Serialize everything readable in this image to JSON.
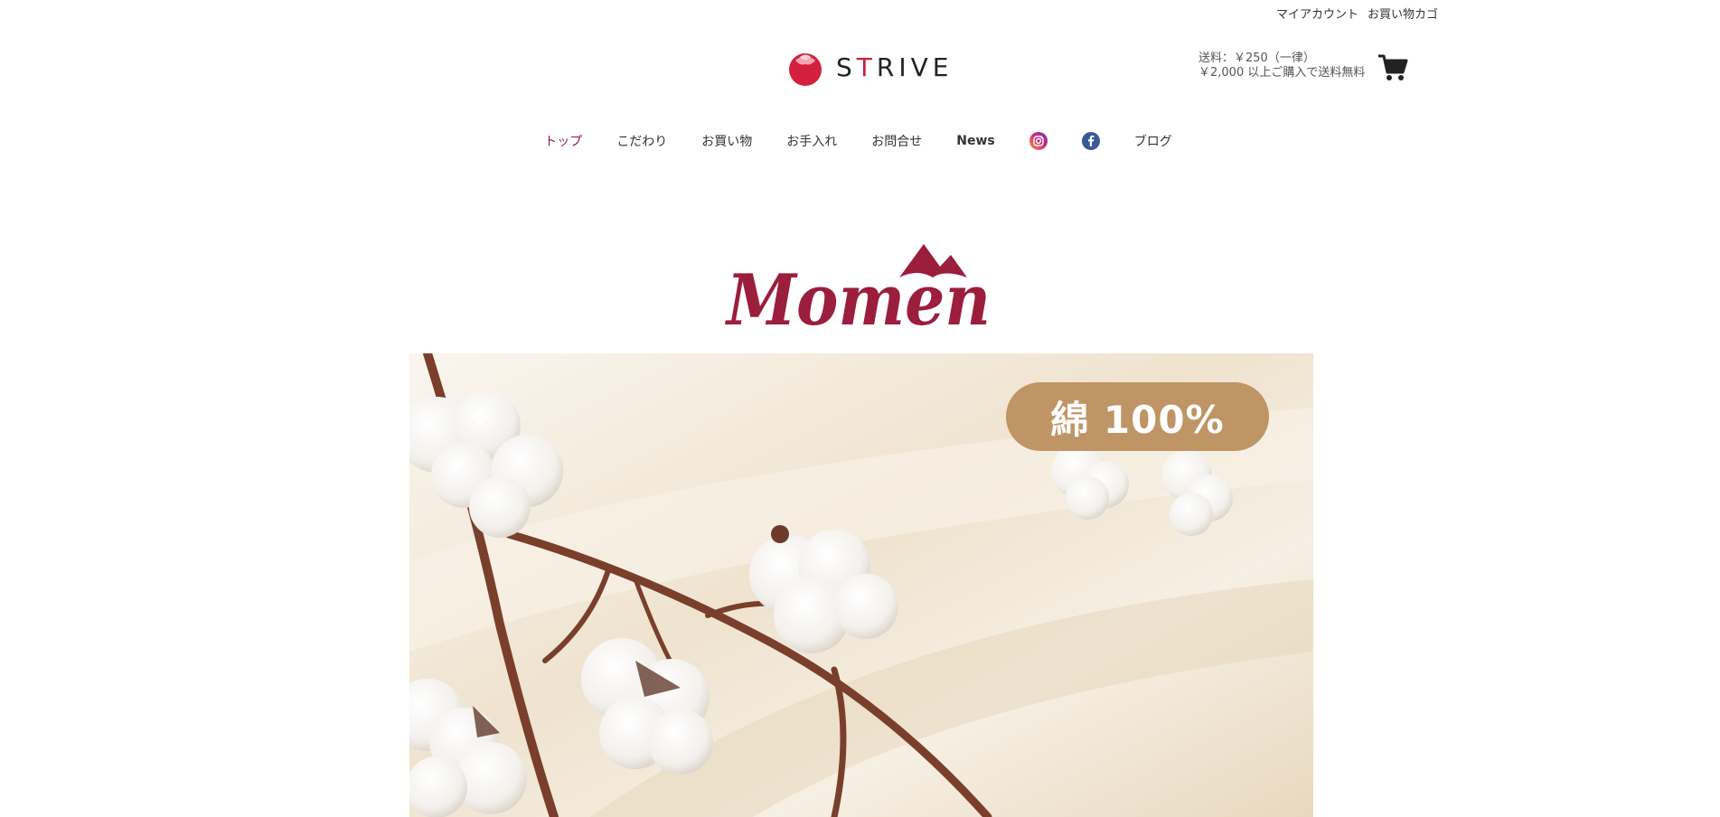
{
  "header": {
    "utility_links": [
      {
        "label": "マイアカウント"
      },
      {
        "label": "お買い物カゴ"
      }
    ],
    "logo": {
      "text_pre": "S",
      "text_accent": "T",
      "text_post": "RIVE",
      "mark_icon": "drop-logo-icon",
      "brand_color": "#c8203c"
    },
    "shipping": {
      "line1": "送料：￥250（一律）",
      "line2": "￥2,000 以上ご購入で送料無料"
    },
    "cart_icon": "shopping-cart-icon"
  },
  "nav": {
    "items": [
      {
        "label": "トップ",
        "active": true
      },
      {
        "label": "こだわり"
      },
      {
        "label": "お買い物"
      },
      {
        "label": "お手入れ"
      },
      {
        "label": "お問合せ"
      },
      {
        "label": "News"
      },
      {
        "icon": "instagram-icon"
      },
      {
        "icon": "facebook-icon"
      },
      {
        "label": "ブログ"
      }
    ],
    "active_color": "#9b1e3c"
  },
  "brand": {
    "name": "Momen",
    "color": "#9b1e3c"
  },
  "hero": {
    "badge_text": "綿 100%",
    "badge_color": "#bf9566"
  }
}
